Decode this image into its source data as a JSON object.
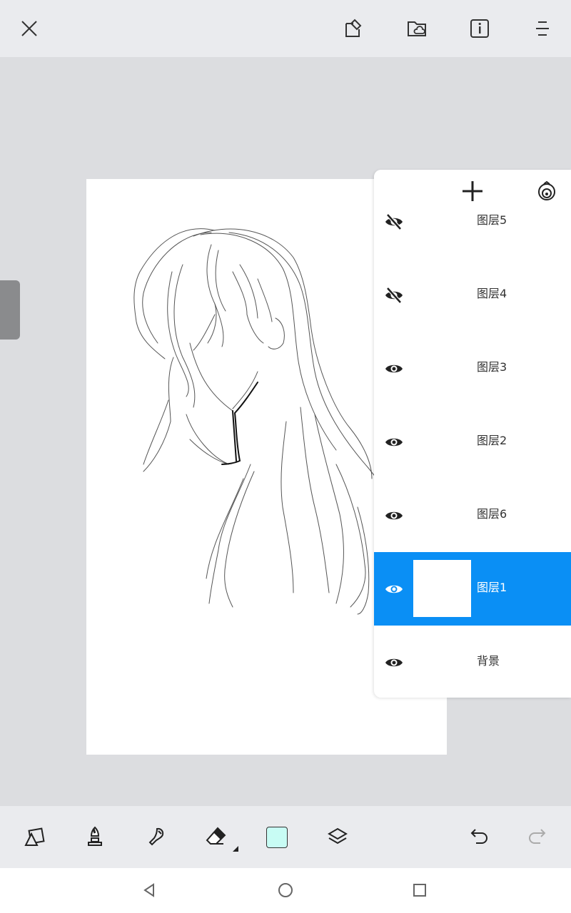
{
  "toolbar": {
    "close_icon": "close-icon",
    "actions": [
      "edit-canvas-icon",
      "cloud-folder-icon",
      "info-icon",
      "menu-icon"
    ]
  },
  "layers_panel": {
    "add_icon": "plus-icon",
    "blend_icon": "blend-mode-icon",
    "layers": [
      {
        "name": "图层5",
        "visible": false,
        "selected": false
      },
      {
        "name": "图层4",
        "visible": false,
        "selected": false
      },
      {
        "name": "图层3",
        "visible": true,
        "selected": false
      },
      {
        "name": "图层2",
        "visible": true,
        "selected": false
      },
      {
        "name": "图层6",
        "visible": true,
        "selected": false
      },
      {
        "name": "图层1",
        "visible": true,
        "selected": true
      },
      {
        "name": "背景",
        "visible": true,
        "selected": false
      }
    ]
  },
  "bottom_tools": {
    "items": [
      "shapes-icon",
      "brush-icon",
      "smudge-icon",
      "eraser-icon",
      "color-swatch",
      "layers-icon",
      "undo-icon",
      "redo-icon"
    ],
    "current_color": "#c8fcf4",
    "accent_color": "#0a8ff5"
  },
  "nav": {
    "items": [
      "back-icon",
      "home-icon",
      "recents-icon"
    ]
  }
}
